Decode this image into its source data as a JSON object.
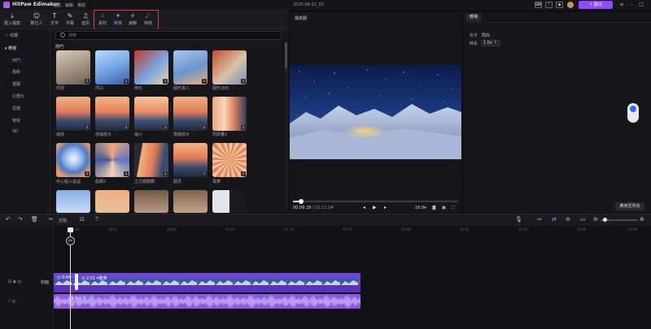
{
  "app": {
    "name": "HitPaw Edimakor",
    "menu": [
      "檔案",
      "編輯",
      "幫助"
    ],
    "doc_title": "2025-08-22_01",
    "export_label": "匯出",
    "accent": "#8e4bff",
    "highlight_box_color": "#e23b3b"
  },
  "toolbar": {
    "tools": [
      {
        "label": "匯入檔案",
        "icon": "import-icon"
      },
      {
        "label": "數位人",
        "icon": "avatar-icon"
      },
      {
        "label": "文字",
        "icon": "text-icon"
      },
      {
        "label": "字幕",
        "icon": "subtitle-icon"
      },
      {
        "label": "音訊",
        "icon": "audio-icon"
      },
      {
        "label": "素材",
        "icon": "assets-icon"
      },
      {
        "label": "轉場",
        "icon": "transition-icon"
      },
      {
        "label": "濾鏡",
        "icon": "filter-icon"
      },
      {
        "label": "特效",
        "icon": "effects-icon"
      }
    ],
    "active": "轉場"
  },
  "sidebar": {
    "favorites": "收藏",
    "group": "轉場",
    "items": [
      "熱門",
      "最新",
      "基礎",
      "幻燈片",
      "逗號",
      "特效",
      "3D"
    ],
    "active": "熱門"
  },
  "content": {
    "search_placeholder": "搜索",
    "section_title": "熱門",
    "thumbnails": [
      {
        "label": "閃現"
      },
      {
        "label": "閃白"
      },
      {
        "label": "擦化"
      },
      {
        "label": "圓形真入"
      },
      {
        "label": "圓形淡出"
      },
      {
        "label": "縮放"
      },
      {
        "label": "放縮放大"
      },
      {
        "label": "縮小"
      },
      {
        "label": "模糊放大"
      },
      {
        "label": "閃屏疊2"
      },
      {
        "label": "中心點火漩溫"
      },
      {
        "label": "旋轉2"
      },
      {
        "label": "立方體翻轉"
      },
      {
        "label": "翻頁"
      },
      {
        "label": "萬華"
      },
      {
        "label": ""
      },
      {
        "label": ""
      },
      {
        "label": ""
      },
      {
        "label": ""
      },
      {
        "label": ""
      }
    ]
  },
  "player": {
    "title": "播放器",
    "current_time": "00:06:29",
    "total_time": "02:11:04",
    "progress": 0.05,
    "aspect": "16:9"
  },
  "properties": {
    "tab": "轉場",
    "name_label": "名字",
    "name_value": "閃白",
    "duration_label": "時長",
    "duration_value": "1.0s",
    "apply_all": "應用至所有"
  },
  "timeline": {
    "split_label": "分割",
    "ruler": [
      "00:00",
      "00:15",
      "00:30",
      "01:15",
      "01:30",
      "01:45",
      "02:00",
      "02:15",
      "02:30",
      "02:45",
      "03:00",
      "03:15",
      "03:30",
      "03:45",
      "04:00"
    ],
    "video_track_label": "封面",
    "clip_tag_1": "0:04",
    "clip_tag_2": "2:01",
    "clip_tag_3": "重命",
    "audio_tag": "1.0s:2.01"
  }
}
